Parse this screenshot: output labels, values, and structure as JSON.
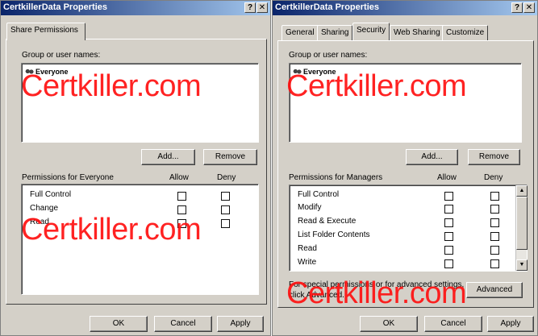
{
  "share_dialog": {
    "title": "CertkillerData Properties",
    "help_btn": "?",
    "close_btn": "✕",
    "tab": "Share Permissions",
    "group_label": "Group or user names:",
    "group_items": [
      "Everyone"
    ],
    "add_button": "Add...",
    "remove_button": "Remove",
    "perm_label": "Permissions for Everyone",
    "allow_header": "Allow",
    "deny_header": "Deny",
    "permissions": [
      "Full Control",
      "Change",
      "Read"
    ],
    "ok": "OK",
    "cancel": "Cancel",
    "apply": "Apply"
  },
  "security_dialog": {
    "title": "CertkillerData Properties",
    "help_btn": "?",
    "close_btn": "✕",
    "tabs": [
      "General",
      "Sharing",
      "Security",
      "Web Sharing",
      "Customize"
    ],
    "active_tab": "Security",
    "group_label": "Group or user names:",
    "group_items": [
      "Everyone"
    ],
    "add_button": "Add...",
    "remove_button": "Remove",
    "perm_label": "Permissions for Managers",
    "allow_header": "Allow",
    "deny_header": "Deny",
    "permissions": [
      "Full Control",
      "Modify",
      "Read & Execute",
      "List Folder Contents",
      "Read",
      "Write"
    ],
    "special_text_1": "For special permissions or for advanced settings,",
    "special_text_2": "click Advanced.",
    "advanced_button": "Advanced",
    "ok": "OK",
    "cancel": "Cancel",
    "apply": "Apply"
  },
  "watermark": "Certkiller.com",
  "colors": {
    "title_gradient_start": "#0a246a",
    "title_gradient_end": "#a6caf0",
    "dialog_face": "#d4d0c8",
    "watermark": "#ff1010"
  }
}
